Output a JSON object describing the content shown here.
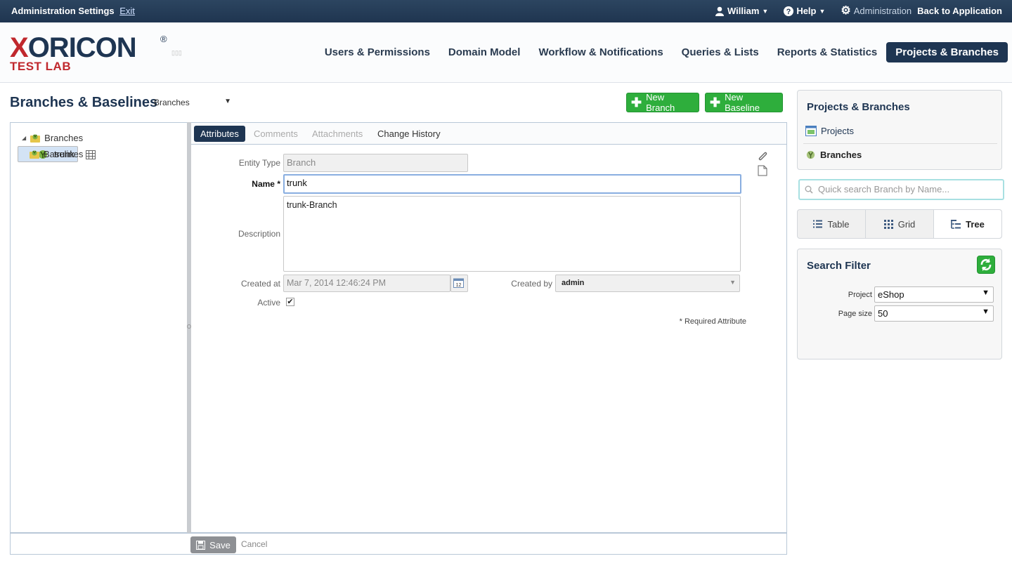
{
  "topbar": {
    "title": "Administration Settings",
    "exit": "Exit",
    "user": "William",
    "help": "Help",
    "admin": "Administration",
    "back": "Back to Application"
  },
  "logo": {
    "name_x": "X",
    "name_rest": "ORICON",
    "reg": "®",
    "sub": "TEST LAB",
    "dots": "▯▯▯"
  },
  "nav": [
    "Users & Permissions",
    "Domain Model",
    "Workflow & Notifications",
    "Queries & Lists",
    "Reports & Statistics",
    "Projects & Branches"
  ],
  "page": {
    "title": "Branches & Baselines",
    "selector": "Branches",
    "new_branch": "New Branch",
    "new_baseline": "New Baseline"
  },
  "tree": {
    "branches": "Branches",
    "trunk": "trunk",
    "baselines": "Baselines"
  },
  "tabs": [
    "Attributes",
    "Comments",
    "Attachments",
    "Change History"
  ],
  "form": {
    "entity_type_label": "Entity Type",
    "entity_type": "Branch",
    "name_label": "Name",
    "required_mark": "*",
    "name": "trunk",
    "description_label": "Description",
    "description": "trunk-Branch",
    "created_at_label": "Created at",
    "created_at": "Mar 7, 2014 12:46:24 PM",
    "calendar_day": "12",
    "created_by_label": "Created by",
    "created_by": "admin",
    "active_label": "Active",
    "active": true,
    "required_note": "* Required Attribute"
  },
  "footer": {
    "save": "Save",
    "cancel": "Cancel"
  },
  "right": {
    "title": "Projects & Branches",
    "projects": "Projects",
    "branches": "Branches",
    "search_placeholder": "Quick search Branch by Name...",
    "views": [
      "Table",
      "Grid",
      "Tree"
    ],
    "active_view": "Tree",
    "filter_title": "Search Filter",
    "project_label": "Project",
    "project_value": "eShop",
    "page_size_label": "Page size",
    "page_size_value": "50"
  },
  "colors": {
    "brand_dark": "#1e3552",
    "brand_red": "#c0282d",
    "green": "#2eae3c"
  }
}
